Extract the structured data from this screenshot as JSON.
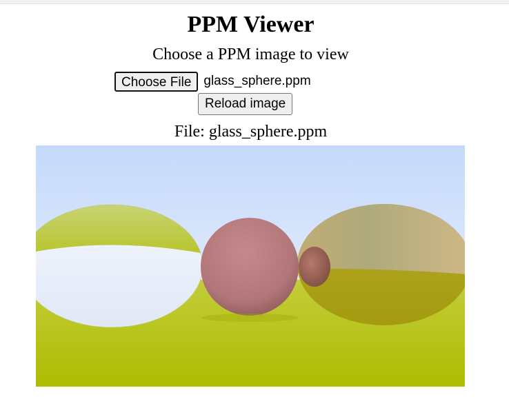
{
  "header": {
    "title": "PPM Viewer",
    "subtitle": "Choose a PPM image to view"
  },
  "file_picker": {
    "button_label": "Choose File",
    "selected_file": "glass_sphere.ppm"
  },
  "reload": {
    "button_label": "Reload image"
  },
  "viewer": {
    "file_caption": "File: glass_sphere.ppm",
    "image_description_icon": "rendered-spheres-image",
    "colors": {
      "sky_top": "#c4d9fb",
      "sky_bottom": "#eef3ff",
      "ground": "#b3c100",
      "glass_sphere": "#e7eef9",
      "diffuse_sphere": "#b77a7d",
      "metal_sphere": "#c9b574"
    }
  }
}
